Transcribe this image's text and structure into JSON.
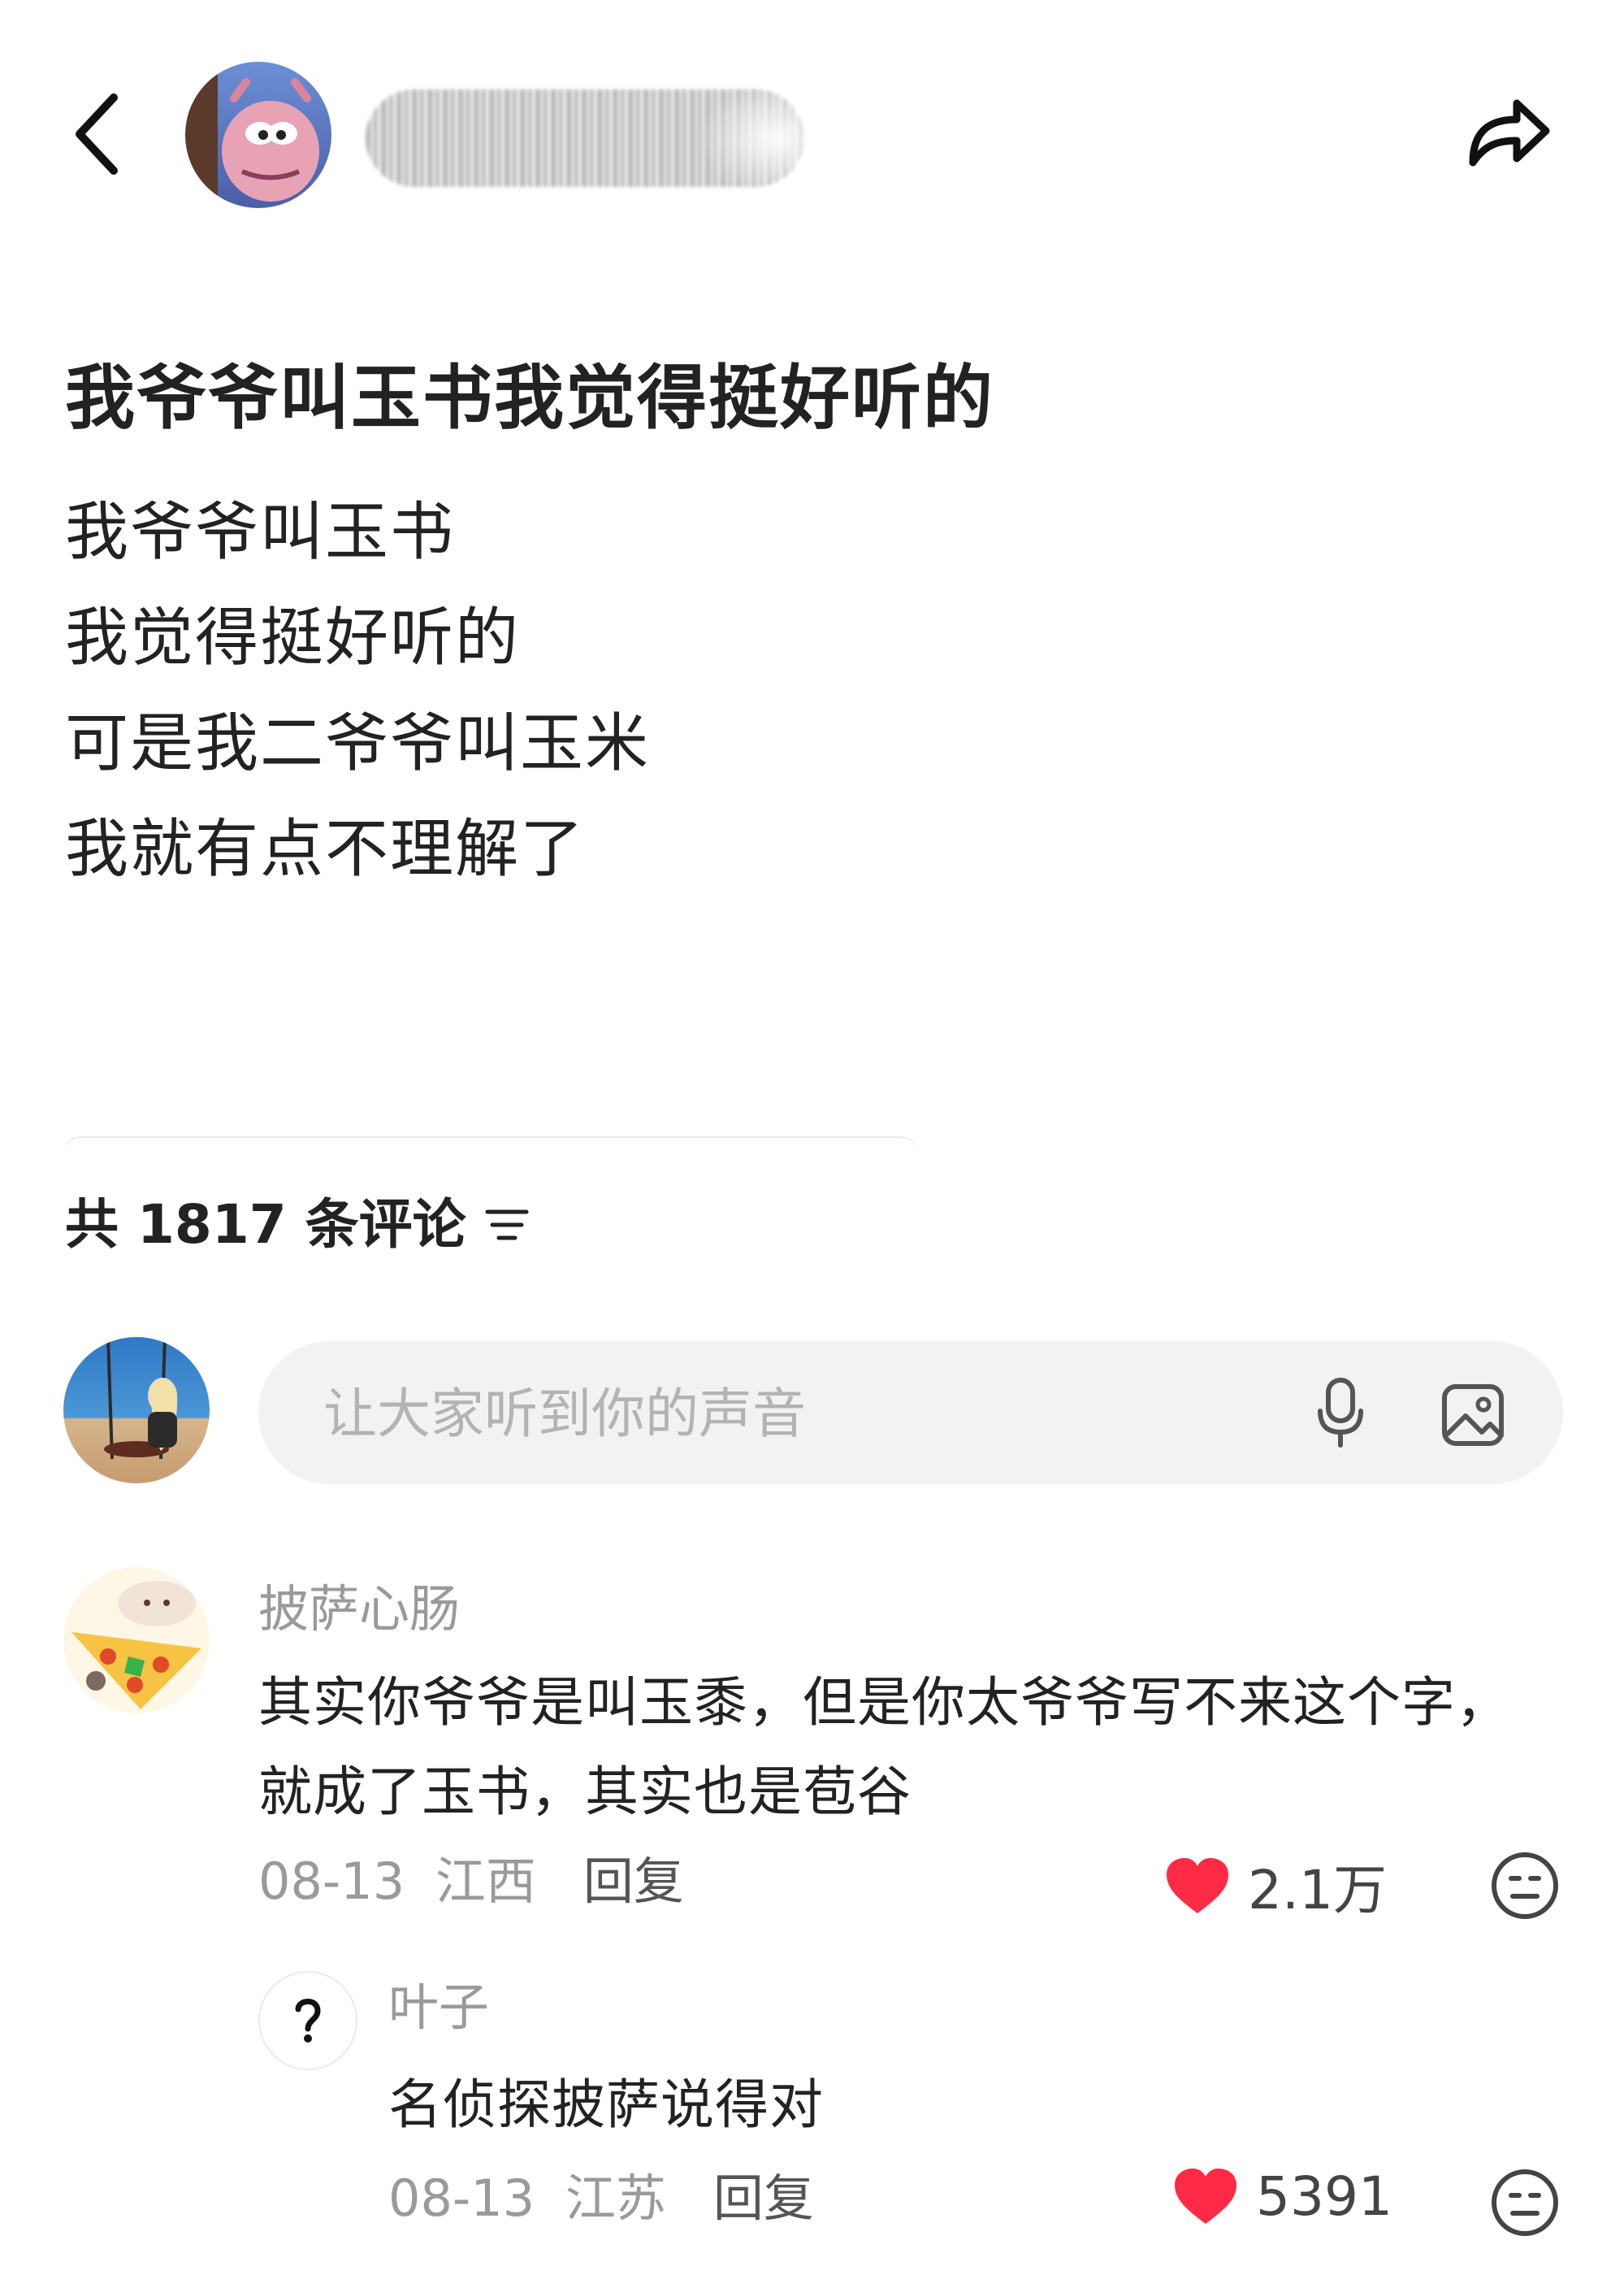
{
  "header": {
    "icons": {
      "back": "back-chevron-icon",
      "share": "share-arrow-icon"
    }
  },
  "post": {
    "title": "我爷爷叫玉书我觉得挺好听的",
    "lines": [
      "我爷爷叫玉书",
      "我觉得挺好听的",
      "可是我二爷爷叫玉米",
      "我就有点不理解了"
    ]
  },
  "comments_header": {
    "label": "共 1817 条评论",
    "sort_icon": "sort-filter-icon"
  },
  "comment_input": {
    "placeholder": "让大家听到你的声音",
    "icons": {
      "mic": "microphone-icon",
      "image": "image-icon"
    }
  },
  "comments": [
    {
      "author": "披萨心肠",
      "text_line1": "其实你爷爷是叫玉黍，但是你太爷爷写不来这个字，",
      "text_line2": "就成了玉书，其实也是苞谷",
      "date": "08-13",
      "location": "江西",
      "reply_label": "回复",
      "likes": "2.1万",
      "colors": {
        "heart": "#ff2a45"
      }
    },
    {
      "author": "叶子",
      "text": "名侦探披萨说得对",
      "date": "08-13",
      "location": "江苏",
      "reply_label": "回复",
      "likes": "5391",
      "colors": {
        "heart": "#ff2a45"
      }
    }
  ]
}
